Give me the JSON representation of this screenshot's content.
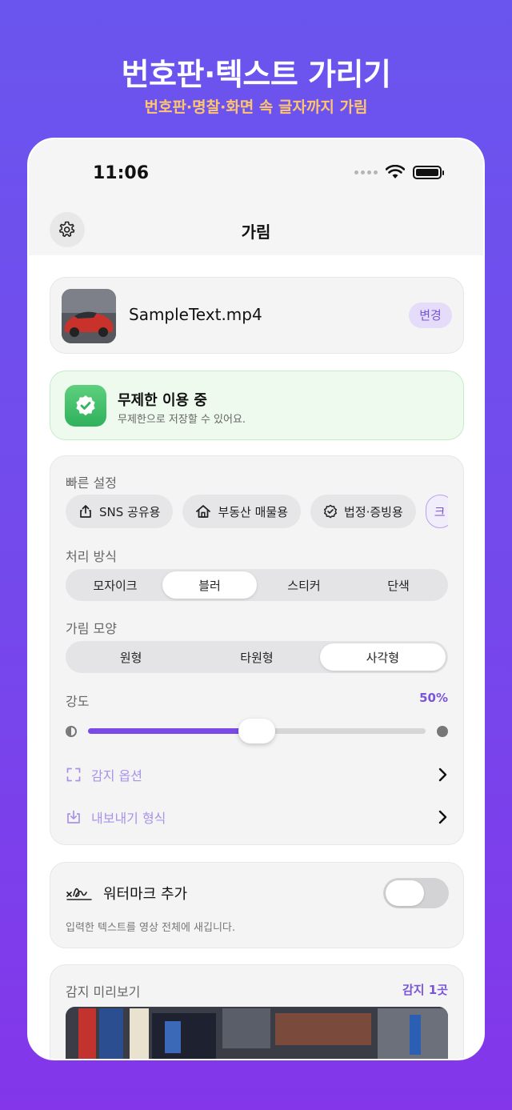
{
  "hero": {
    "title": "번호판·텍스트 가리기",
    "subtitle": "번호판·명찰·화면 속 글자까지 가림"
  },
  "status_bar": {
    "time": "11:06"
  },
  "nav": {
    "title": "가림"
  },
  "file": {
    "name": "SampleText.mp4",
    "change_label": "변경"
  },
  "unlimited": {
    "title": "무제한 이용 중",
    "subtitle": "무제한으로 저장할 수 있어요."
  },
  "settings": {
    "quick_label": "빠른 설정",
    "quick_chips": [
      {
        "label": "SNS 공유용",
        "icon": "share-icon"
      },
      {
        "label": "부동산 매물용",
        "icon": "home-icon"
      },
      {
        "label": "법정·증빙용",
        "icon": "verified-badge-icon"
      },
      {
        "label": "크"
      }
    ],
    "method_label": "처리 방식",
    "methods": [
      "모자이크",
      "블러",
      "스티커",
      "단색"
    ],
    "method_selected": "블러",
    "shape_label": "가림 모양",
    "shapes": [
      "원형",
      "타원형",
      "사각형"
    ],
    "shape_selected": "사각형",
    "strength_label": "강도",
    "strength_value": "50%",
    "strength_fraction": 0.5,
    "detect_options_label": "감지 옵션",
    "export_format_label": "내보내기 형식"
  },
  "watermark": {
    "title": "워터마크 추가",
    "description": "입력한 텍스트를 영상 전체에 새깁니다.",
    "enabled": false
  },
  "preview": {
    "label": "감지 미리보기",
    "count": "감지 1곳"
  },
  "colors": {
    "accent": "#7a4ae6",
    "success": "#2fb15b",
    "highlight": "#ffc56e"
  }
}
